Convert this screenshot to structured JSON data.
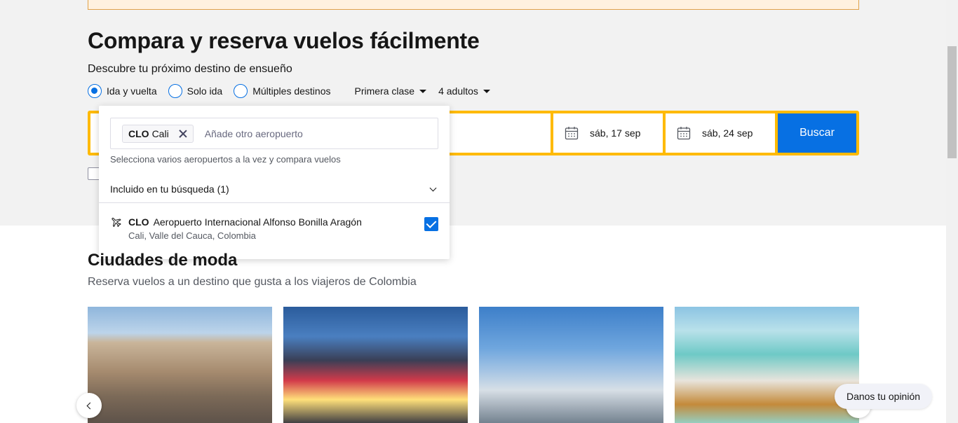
{
  "hero": {
    "title": "Compara y reserva vuelos fácilmente",
    "subtitle": "Descubre tu próximo destino de ensueño"
  },
  "trip_type": {
    "options": [
      {
        "label": "Ida y vuelta",
        "selected": true
      },
      {
        "label": "Solo ida",
        "selected": false
      },
      {
        "label": "Múltiples destinos",
        "selected": false
      }
    ]
  },
  "cabin_class": "Primera clase",
  "travellers": "4 adultos",
  "search": {
    "depart_date": "sáb, 17 sep",
    "return_date": "sáb, 24 sep",
    "button_label": "Buscar"
  },
  "origin_popover": {
    "chip_code": "CLO",
    "chip_city": "Cali",
    "add_placeholder": "Añade otro aeropuerto",
    "helper": "Selecciona varios aeropuertos a la vez y compara vuelos",
    "included_label": "Incluido en tu búsqueda (1)",
    "airport": {
      "code": "CLO",
      "name": "Aeropuerto Internacional Alfonso Bonilla Aragón",
      "location": "Cali, Valle del Cauca, Colombia",
      "checked": true
    }
  },
  "trending": {
    "title": "Ciudades de moda",
    "subtitle": "Reserva vuelos a un destino que gusta a los viajeros de Colombia"
  },
  "feedback_label": "Danos tu opinión",
  "colors": {
    "accent": "#0770e3",
    "search_frame": "#feba02",
    "hero_background": "#f2f2f2"
  }
}
